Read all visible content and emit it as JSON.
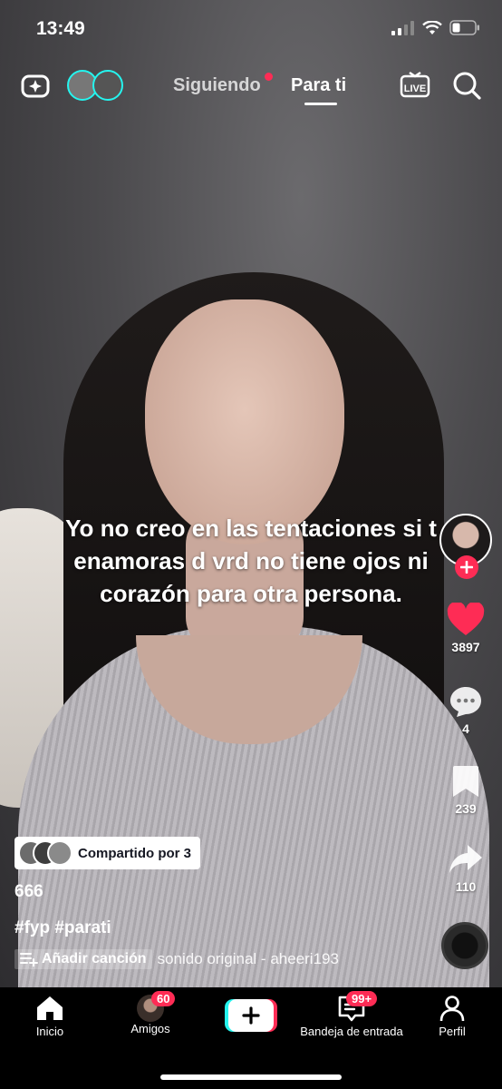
{
  "status": {
    "time": "13:49"
  },
  "top_tabs": {
    "following": "Siguiendo",
    "for_you": "Para ti"
  },
  "video": {
    "overlay_text": "Yo no creo en las tentaciones si t enamoras d vrd no tiene ojos ni corazón para otra persona."
  },
  "actions": {
    "likes": "3897",
    "comments": "4",
    "saves": "239",
    "shares": "110"
  },
  "caption": {
    "shared_by": "Compartido por 3",
    "username": "666",
    "hashtags": "#fyp #parati",
    "add_song": "Añadir canción",
    "sound": "sonido original - aheeri193"
  },
  "nav": {
    "home": "Inicio",
    "friends": "Amigos",
    "friends_badge": "60",
    "inbox": "Bandeja de entrada",
    "inbox_badge": "99+",
    "profile": "Perfil"
  },
  "colors": {
    "accent": "#fe2c55",
    "cyan": "#25f4ee"
  }
}
